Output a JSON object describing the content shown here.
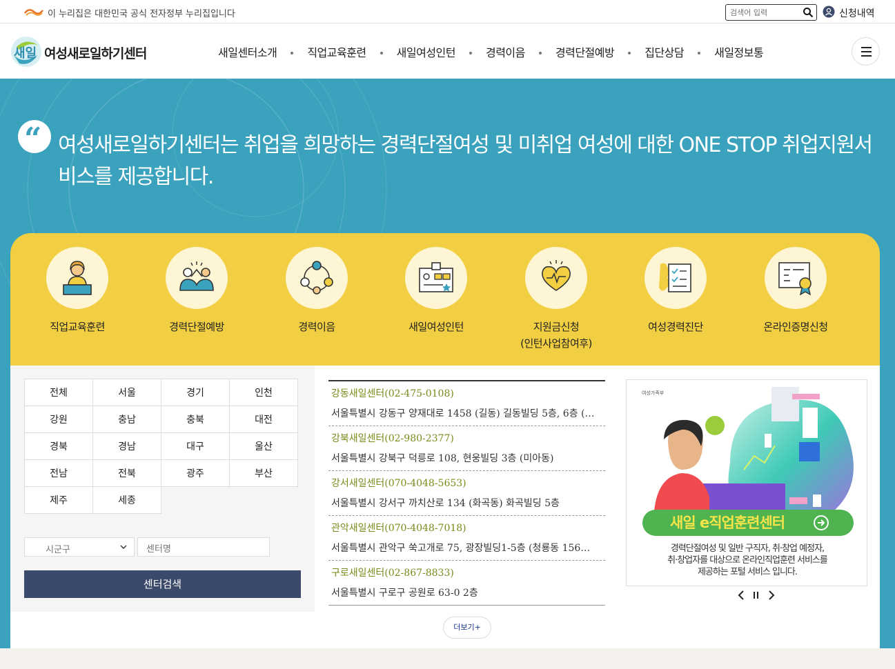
{
  "gov": {
    "text": "이 누리집은 대한민국 공식 전자정부 누리집입니다",
    "search_placeholder": "검색어 입력",
    "apply_label": "신청내역"
  },
  "header": {
    "logo_text": "여성새로일하기센터",
    "nav": [
      "새일센터소개",
      "직업교육훈련",
      "새일여성인턴",
      "경력이음",
      "경력단절예방",
      "집단상담",
      "새일정보통"
    ]
  },
  "hero": {
    "text": "여성새로일하기센터는 취업을 희망하는 경력단절여성 및 미취업 여성에 대한 ONE STOP 취업지원서비스를 제공합니다."
  },
  "services": [
    {
      "label": "직업교육훈련",
      "icon": "teacher-icon"
    },
    {
      "label": "경력단절예방",
      "icon": "people-icon"
    },
    {
      "label": "경력이음",
      "icon": "network-icon"
    },
    {
      "label": "새일여성인턴",
      "icon": "id-card-icon"
    },
    {
      "label": "지원금신청\n(인턴사업참여후)",
      "icon": "heart-hand-icon"
    },
    {
      "label": "여성경력진단",
      "icon": "checklist-icon"
    },
    {
      "label": "온라인증명신청",
      "icon": "certificate-icon"
    }
  ],
  "regions": [
    "전체",
    "서울",
    "경기",
    "인천",
    "강원",
    "충남",
    "충북",
    "대전",
    "경북",
    "경남",
    "대구",
    "울산",
    "전남",
    "전북",
    "광주",
    "부산",
    "제주",
    "세종"
  ],
  "search": {
    "sgg_placeholder": "시군구",
    "center_placeholder": "센터명",
    "button_label": "센터검색"
  },
  "centers": [
    {
      "name": "강동새일센터(02-475-0108)",
      "address": "서울특별시 강동구 양재대로 1458 (길동) 길동빌딩 5층, 6층 (…"
    },
    {
      "name": "강북새일센터(02-980-2377)",
      "address": "서울특별시 강북구 덕릉로 108, 현웅빌딩 3층 (미아동)"
    },
    {
      "name": "강서새일센터(070-4048-5653)",
      "address": "서울특별시 강서구 까치산로 134 (화곡동) 화곡빌딩 5층"
    },
    {
      "name": "관악새일센터(070-4048-7018)",
      "address": "서울특별시 관악구 쑥고개로 75, 광장빌딩1-5층 (청룡동 156…"
    },
    {
      "name": "구로새일센터(02-867-8833)",
      "address": "서울특별시 구로구 공원로 63-0 2층"
    }
  ],
  "more_label": "더보기+",
  "banner": {
    "ministry": "여성가족부",
    "title": "새일 e직업훈련센터",
    "desc_line1": "경력단절여성 및 일반 구직자, 취·창업 예정자,",
    "desc_line2": "취·창업자를 대상으로 온라인직업훈련 서비스를",
    "desc_line3": "제공하는 포털 서비스 입니다."
  },
  "colors": {
    "hero_bg": "#3ba2bd",
    "service_bg": "#f2cf42",
    "search_button": "#3b4a6b",
    "center_name": "#7a8a1a"
  }
}
